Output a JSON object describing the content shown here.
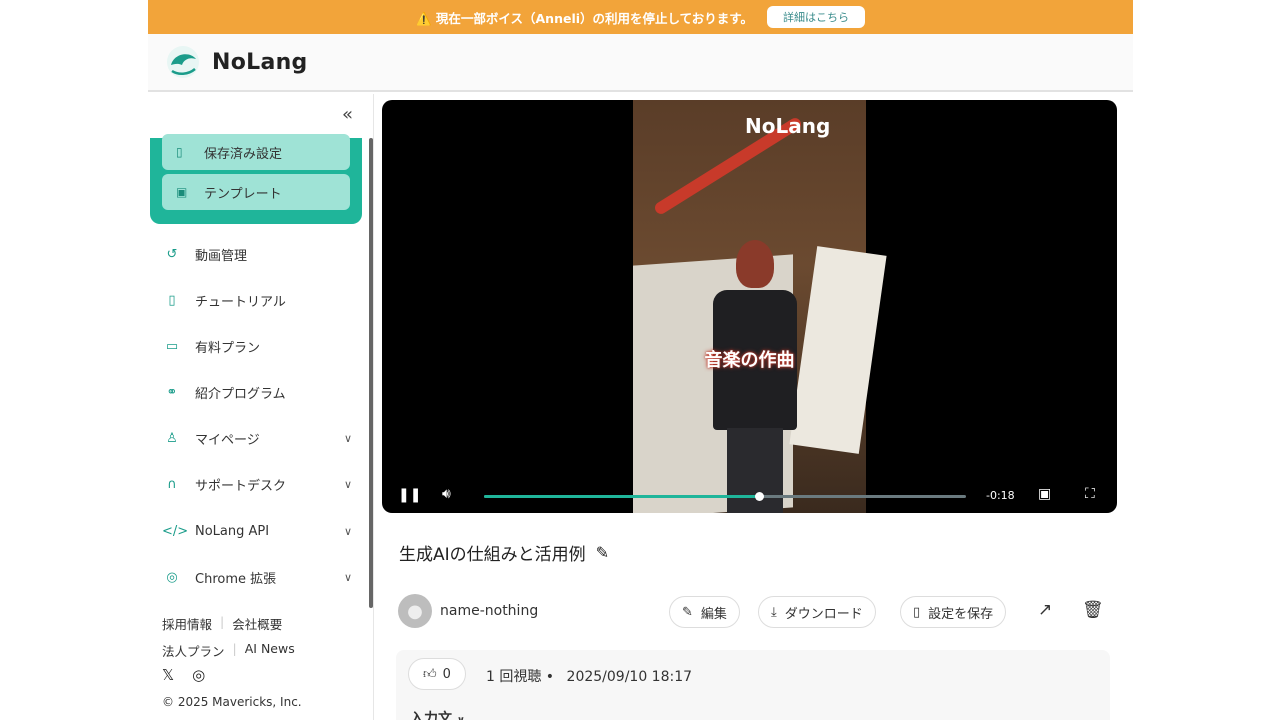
{
  "banner": {
    "text": "⚠️ 現在一部ボイス（Anneli）の利用を停止しております。",
    "button": "詳細はこちら"
  },
  "header": {
    "logo_text": "NoLang"
  },
  "sidebar": {
    "collapse_icon": "double-chevron-left-icon",
    "cards": [
      {
        "label": "保存済み設定",
        "icon": "bookmark-icon"
      },
      {
        "label": "テンプレート",
        "icon": "image-icon"
      }
    ],
    "items": [
      {
        "label": "動画管理",
        "icon": "history-icon"
      },
      {
        "label": "チュートリアル",
        "icon": "book-icon"
      },
      {
        "label": "有料プラン",
        "icon": "card-icon"
      },
      {
        "label": "紹介プログラム",
        "icon": "handshake-icon"
      },
      {
        "label": "マイページ",
        "icon": "user-icon",
        "expandable": true
      },
      {
        "label": "サポートデスク",
        "icon": "headset-icon",
        "expandable": true
      },
      {
        "label": "NoLang API",
        "icon": "code-icon",
        "expandable": true
      },
      {
        "label": "Chrome 拡張",
        "icon": "chrome-icon",
        "expandable": true
      }
    ],
    "footer": {
      "row1": [
        "採用情報",
        "会社概要"
      ],
      "row2": [
        "法人プラン",
        "AI News"
      ],
      "copyright": "© 2025 Mavericks, Inc."
    }
  },
  "video": {
    "logo": "NoLang",
    "caption": "音楽の作曲",
    "time_remaining": "-0:18",
    "progress": 0.57
  },
  "main": {
    "title": "生成AIの仕組みと活用例",
    "username": "name-nothing",
    "actions": {
      "edit": "編集",
      "download": "ダウンロード",
      "save": "設定を保存"
    },
    "likes": "0",
    "views": "1 回視聴 •",
    "date": "2025/09/10 18:17",
    "input_label": "入力文"
  }
}
